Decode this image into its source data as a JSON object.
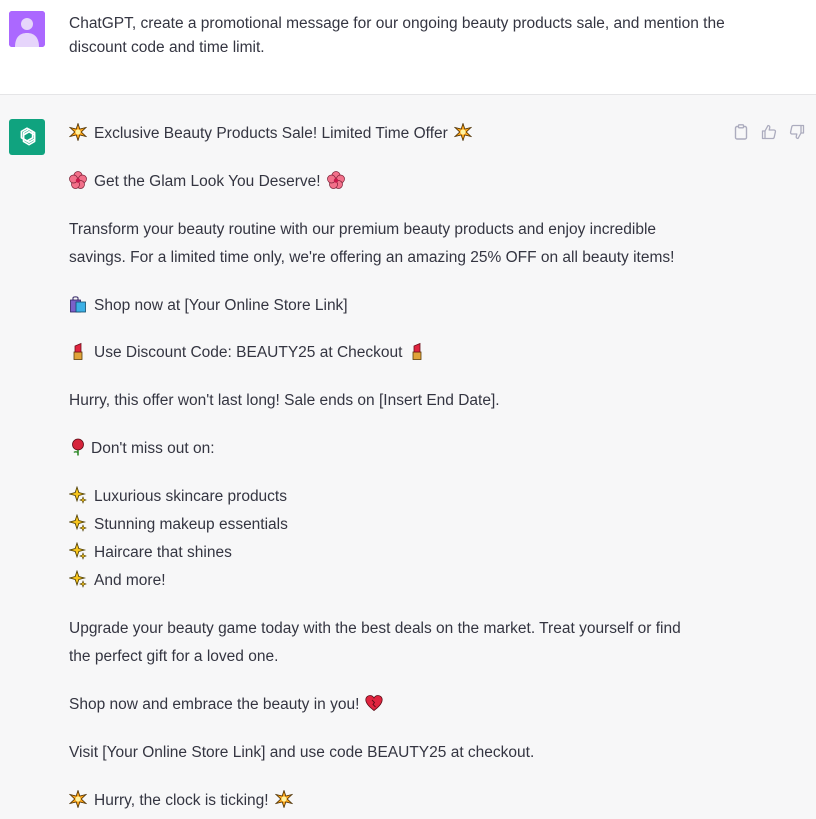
{
  "user": {
    "message": "ChatGPT, create a promotional message for our ongoing beauty products sale, and mention the discount code and time limit."
  },
  "assistant": {
    "headline": "Exclusive Beauty Products Sale! Limited Time Offer",
    "subhead": "Get the Glam Look You Deserve!",
    "para1_line1": "Transform your beauty routine with our premium beauty products and enjoy incredible",
    "para1_line2": "savings. For a limited time only, we're offering an amazing 25% OFF on all beauty items!",
    "shop_now": "Shop now at [Your Online Store Link]",
    "discount": "Use Discount Code: BEAUTY25 at Checkout",
    "hurry": "Hurry, this offer won't last long! Sale ends on [Insert End Date].",
    "dont_miss": "Don't miss out on:",
    "bullets": [
      "Luxurious skincare products",
      "Stunning makeup essentials",
      "Haircare that shines",
      "And more!"
    ],
    "upgrade_line1": "Upgrade your beauty game today with the best deals on the market. Treat yourself or find",
    "upgrade_line2": "the perfect gift for a loved one.",
    "embrace": "Shop now and embrace the beauty in you!",
    "visit": "Visit [Your Online Store Link] and use code BEAUTY25 at checkout.",
    "ticking": "Hurry, the clock is ticking!"
  },
  "icons": {
    "sparkle": "glowing-star-icon",
    "flower": "hibiscus-icon",
    "bag": "shopping-bags-icon",
    "lipstick": "lipstick-icon",
    "rose": "rose-icon",
    "sparkles": "sparkles-icon",
    "heart": "heart-icon",
    "copy": "clipboard-icon",
    "thumbs_up": "thumbs-up-icon",
    "thumbs_down": "thumbs-down-icon"
  },
  "colors": {
    "user_avatar": "#ab68ff",
    "assistant_avatar": "#10a37f",
    "assistant_bg": "#f7f7f8",
    "text": "#343541"
  }
}
